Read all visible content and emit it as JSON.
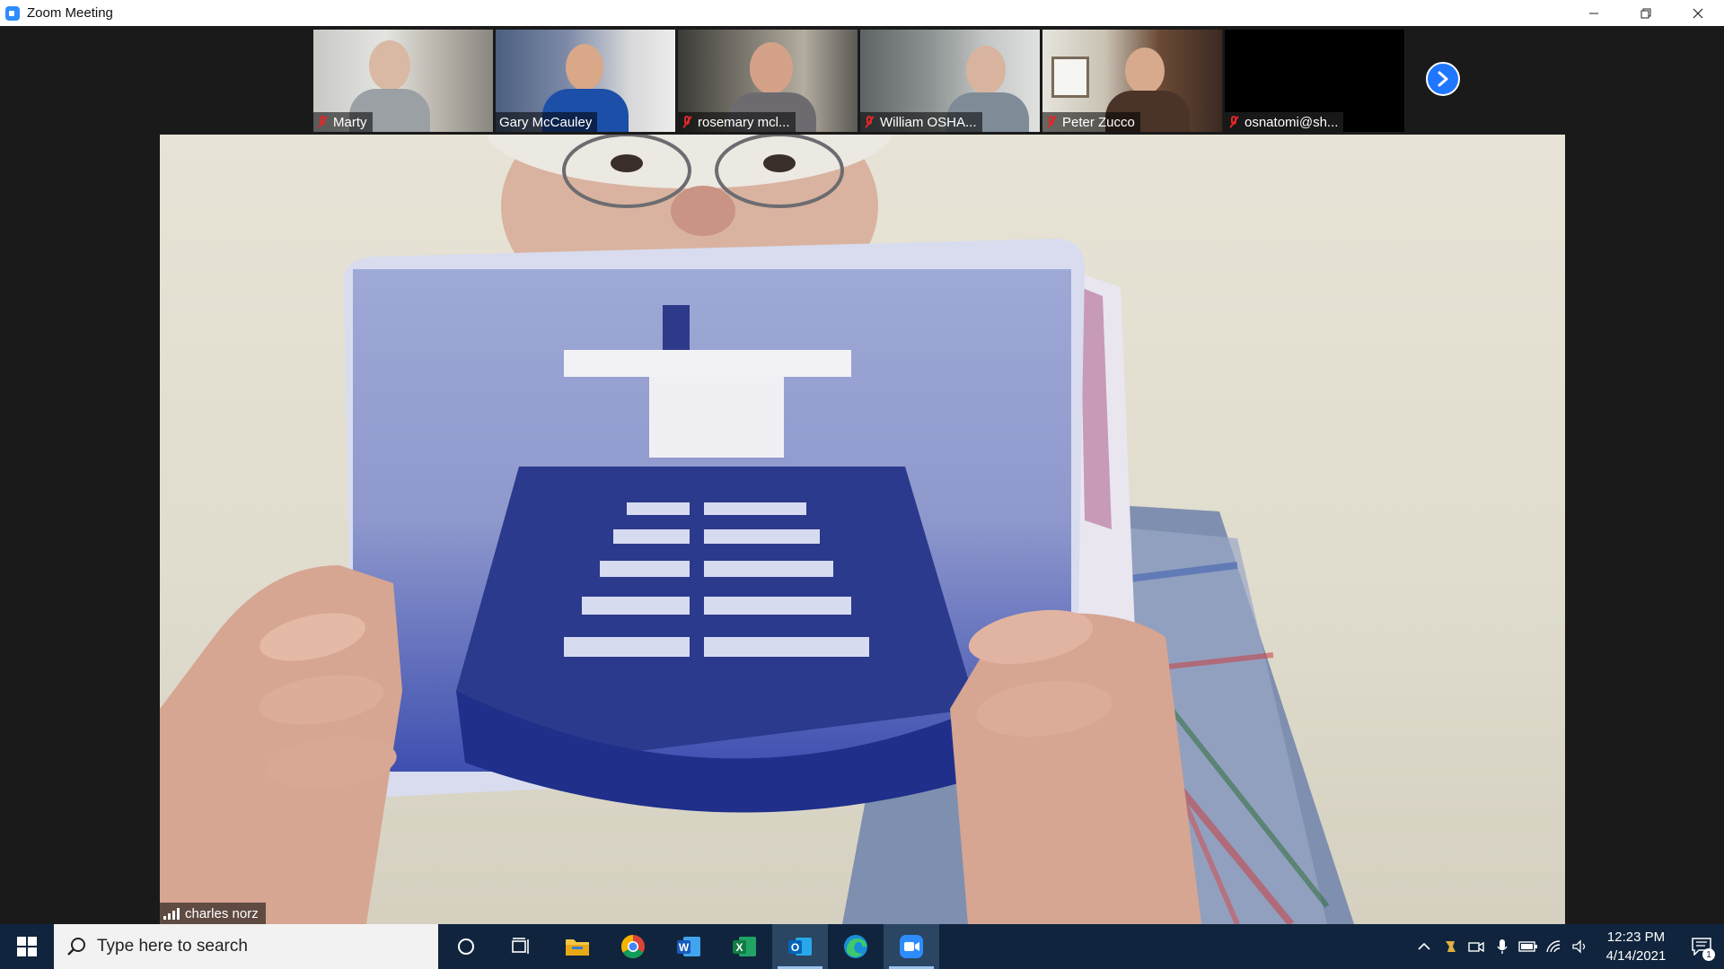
{
  "window": {
    "title": "Zoom Meeting"
  },
  "participants": [
    {
      "name": "Marty",
      "muted": true
    },
    {
      "name": "Gary McCauley",
      "muted": false
    },
    {
      "name": "rosemary mcl...",
      "muted": true
    },
    {
      "name": "William OSHA...",
      "muted": true
    },
    {
      "name": "Peter Zucco",
      "muted": true
    },
    {
      "name": "osnatomi@sh...",
      "muted": true
    }
  ],
  "active_speaker": {
    "name": "charles norz"
  },
  "taskbar": {
    "search_placeholder": "Type here to search",
    "apps": [
      "cortana",
      "task-view",
      "file-explorer",
      "chrome",
      "word",
      "excel",
      "outlook",
      "edge",
      "zoom"
    ],
    "clock_time": "12:23 PM",
    "clock_date": "4/14/2021",
    "notification_count": "1"
  },
  "colors": {
    "taskbar_bg": "#10253d",
    "zoom_blue": "#2d8cff",
    "mute_red": "#e02828"
  }
}
